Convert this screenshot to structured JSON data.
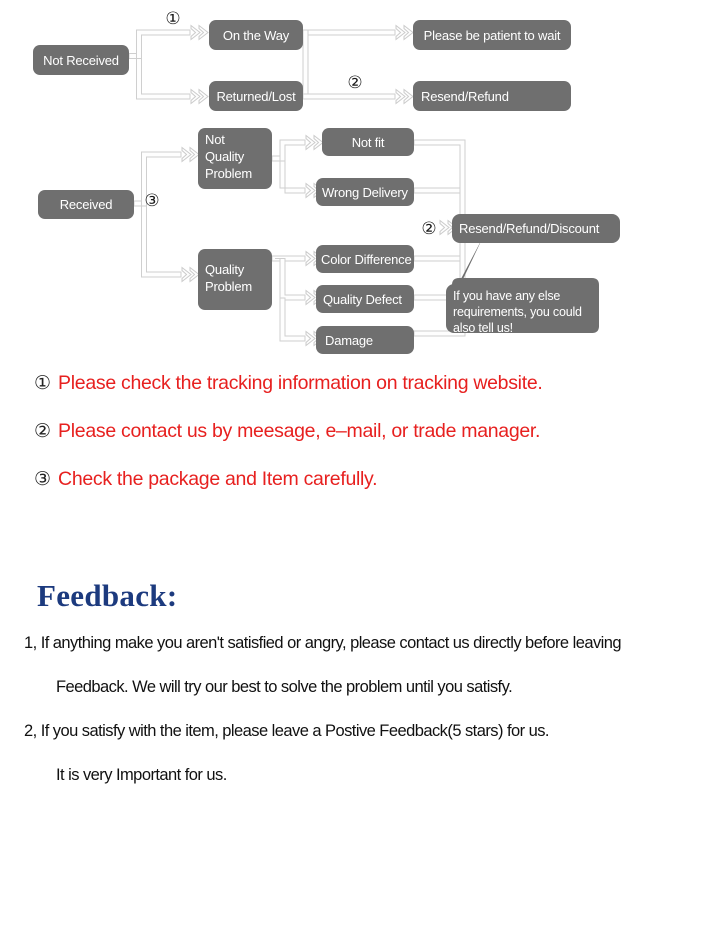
{
  "colors": {
    "node_fill": "#6f6f6f",
    "node_text": "#ffffff",
    "connector_stroke": "#cfcfcf",
    "note_red": "#e7201f",
    "heading_navy": "#1c3a7e",
    "page_background": "#ffffff"
  },
  "flowchart": {
    "nodes": {
      "not_received": "Not Received",
      "on_the_way": "On the Way",
      "returned_lost": "Returned/Lost",
      "please_be_patient": "Please be patient to wait",
      "resend_refund": "Resend/Refund",
      "received": "Received",
      "not_quality_problem_line1": "Not",
      "not_quality_problem_line2": "Quality",
      "not_quality_problem_line3": "Problem",
      "quality_problem_line1": "Quality",
      "quality_problem_line2": "Problem",
      "not_fit": "Not fit",
      "wrong_delivery": "Wrong Delivery",
      "color_difference": "Color Difference",
      "quality_defect": "Quality Defect",
      "damage": "Damage",
      "resend_refund_discount": "Resend/Refund/Discount"
    },
    "markers": {
      "marker_1": "①",
      "marker_2_top": "②",
      "marker_2_right": "②",
      "marker_3": "③"
    },
    "callout": {
      "line1": "If you have any else",
      "line2": "requirements, you could",
      "line3": "also tell us!"
    }
  },
  "notes": [
    {
      "marker": "①",
      "text": "Please check the tracking information on tracking website."
    },
    {
      "marker": "②",
      "text": "Please contact us by meesage, e–mail, or trade manager."
    },
    {
      "marker": "③",
      "text": "Check the package and Item carefully."
    }
  ],
  "feedback": {
    "heading": "Feedback:",
    "lines": [
      {
        "text": "1, If anything make you aren't satisfied or angry, please contact us directly before leaving",
        "indent": false
      },
      {
        "text": "Feedback. We will try our best to solve the problem until you satisfy.",
        "indent": true
      },
      {
        "text": "2, If you satisfy with the item, please leave a Postive Feedback(5 stars) for us.",
        "indent": false
      },
      {
        "text": "It is very Important for us.",
        "indent": true
      }
    ]
  }
}
